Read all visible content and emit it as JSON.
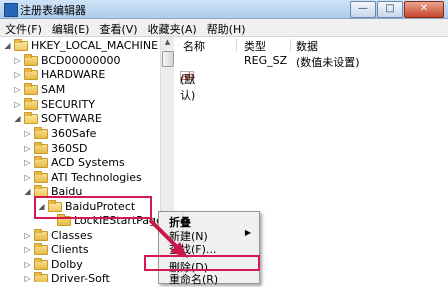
{
  "window": {
    "title": "注册表编辑器",
    "controls": [
      "—",
      "□",
      "✕"
    ]
  },
  "menubar": [
    "文件(F)",
    "编辑(E)",
    "查看(V)",
    "收藏夹(A)",
    "帮助(H)"
  ],
  "tree": {
    "root": "HKEY_LOCAL_MACHINE",
    "items": [
      {
        "label": "BCD00000000"
      },
      {
        "label": "HARDWARE"
      },
      {
        "label": "SAM"
      },
      {
        "label": "SECURITY"
      },
      {
        "label": "SOFTWARE"
      },
      {
        "label": "360Safe"
      },
      {
        "label": "360SD"
      },
      {
        "label": "ACD Systems"
      },
      {
        "label": "ATI Technologies"
      },
      {
        "label": "Baidu"
      },
      {
        "label": "BaiduProtect"
      },
      {
        "label": "LockIEStartPage"
      },
      {
        "label": "Classes"
      },
      {
        "label": "Clients"
      },
      {
        "label": "Dolby"
      },
      {
        "label": "Driver-Soft"
      }
    ]
  },
  "values_pane": {
    "columns": [
      "名称",
      "类型",
      "数据"
    ],
    "rows": [
      {
        "name": "(默认)",
        "icon": "ab",
        "type": "REG_SZ",
        "data": "(数值未设置)"
      }
    ]
  },
  "context_menu": {
    "items": [
      {
        "label": "折叠",
        "bold": true
      },
      {
        "label": "新建(N)",
        "submenu": true
      },
      {
        "label": "查找(F)..."
      },
      {
        "label": "删除(D)",
        "highlighted": true
      },
      {
        "label": "重命名(R)"
      }
    ]
  },
  "colors": {
    "highlight_border": "#d41a4e",
    "arrow": "#c8194a",
    "folder": "#e6b947"
  }
}
